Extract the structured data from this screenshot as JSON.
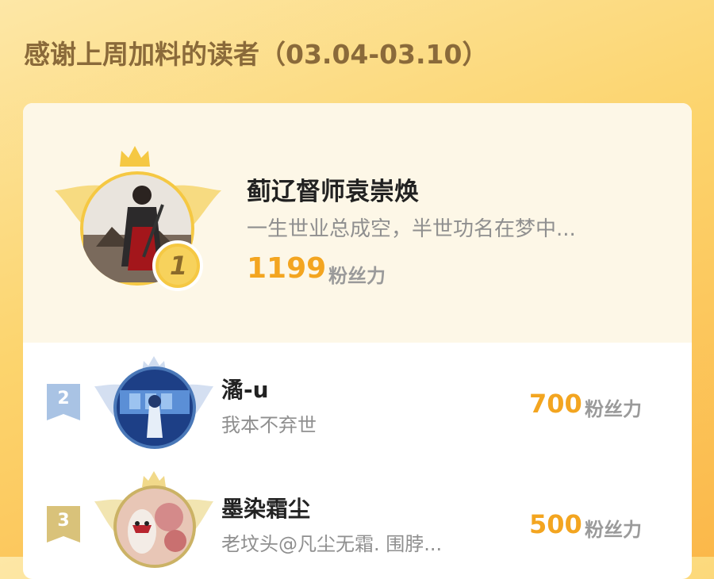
{
  "header": {
    "title": "感谢上周加料的读者（03.04-03.10）"
  },
  "first": {
    "rank": "1",
    "name": "蓟辽督师袁崇焕",
    "bio": "一生世业总成空，半世功名在梦中...",
    "score": "1199",
    "unit": "粉丝力"
  },
  "list": [
    {
      "rank": "2",
      "name": "潏-u",
      "bio": "我本不弃世",
      "score": "700",
      "unit": "粉丝力"
    },
    {
      "rank": "3",
      "name": "墨染霜尘",
      "bio": "老坟头@凡尘无霜. 围脖...",
      "score": "500",
      "unit": "粉丝力"
    }
  ],
  "colors": {
    "score": "#f3a520",
    "gold": "#f5c843",
    "silver": "#a9c3e4",
    "bronze": "#d9c27a"
  }
}
